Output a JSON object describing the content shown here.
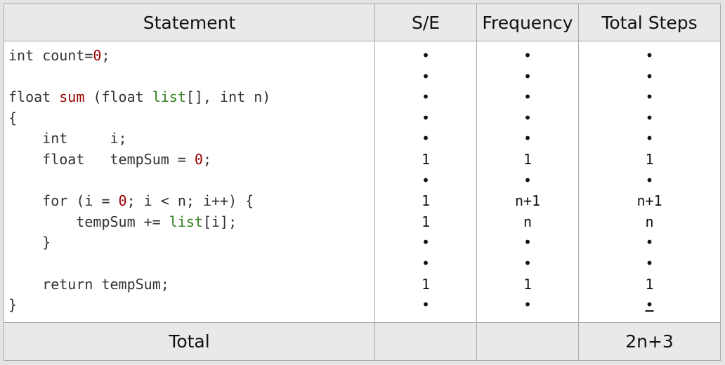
{
  "headers": {
    "statement": "Statement",
    "se": "S/E",
    "frequency": "Frequency",
    "total_steps": "Total Steps"
  },
  "code_lines": [
    {
      "indent": "",
      "parts": [
        {
          "t": "int count=",
          "c": "plain"
        },
        {
          "t": "0",
          "c": "num"
        },
        {
          "t": ";",
          "c": "plain"
        }
      ]
    },
    {
      "indent": "",
      "parts": []
    },
    {
      "indent": "",
      "parts": [
        {
          "t": "float ",
          "c": "plain"
        },
        {
          "t": "sum",
          "c": "fn"
        },
        {
          "t": " (float ",
          "c": "plain"
        },
        {
          "t": "list",
          "c": "arg"
        },
        {
          "t": "[], int n)",
          "c": "plain"
        }
      ]
    },
    {
      "indent": "",
      "parts": [
        {
          "t": "{",
          "c": "plain"
        }
      ]
    },
    {
      "indent": "    ",
      "parts": [
        {
          "t": "int     i;",
          "c": "plain"
        }
      ]
    },
    {
      "indent": "    ",
      "parts": [
        {
          "t": "float   tempSum = ",
          "c": "plain"
        },
        {
          "t": "0",
          "c": "num"
        },
        {
          "t": ";",
          "c": "plain"
        }
      ]
    },
    {
      "indent": "",
      "parts": []
    },
    {
      "indent": "    ",
      "parts": [
        {
          "t": "for (i = ",
          "c": "plain"
        },
        {
          "t": "0",
          "c": "num"
        },
        {
          "t": "; i < n; i++) {",
          "c": "plain"
        }
      ]
    },
    {
      "indent": "        ",
      "parts": [
        {
          "t": "tempSum += ",
          "c": "plain"
        },
        {
          "t": "list",
          "c": "arg"
        },
        {
          "t": "[i];",
          "c": "plain"
        }
      ]
    },
    {
      "indent": "    ",
      "parts": [
        {
          "t": "}",
          "c": "plain"
        }
      ]
    },
    {
      "indent": "",
      "parts": []
    },
    {
      "indent": "    ",
      "parts": [
        {
          "t": "return tempSum;",
          "c": "plain"
        }
      ]
    },
    {
      "indent": "",
      "parts": [
        {
          "t": "}",
          "c": "plain"
        }
      ]
    }
  ],
  "se_values": [
    "•",
    "•",
    "•",
    "•",
    "•",
    "1",
    "•",
    "1",
    "1",
    "•",
    "•",
    "1",
    "•"
  ],
  "frequency_values": [
    "•",
    "•",
    "•",
    "•",
    "•",
    "1",
    "•",
    "n+1",
    "n",
    "•",
    "•",
    "1",
    "•"
  ],
  "total_values": [
    "•",
    "•",
    "•",
    "•",
    "•",
    "1",
    "•",
    "n+1",
    "n",
    "•",
    "•",
    "1",
    "•"
  ],
  "total_underlined_index": 12,
  "footer": {
    "label": "Total",
    "value": "2n+3"
  },
  "colors": {
    "header_bg": "#e9e9e9",
    "border": "#a9a9a9",
    "number": "#990000",
    "function_name": "#990000",
    "identifier": "#2f7d1c",
    "code_text": "#333333"
  }
}
